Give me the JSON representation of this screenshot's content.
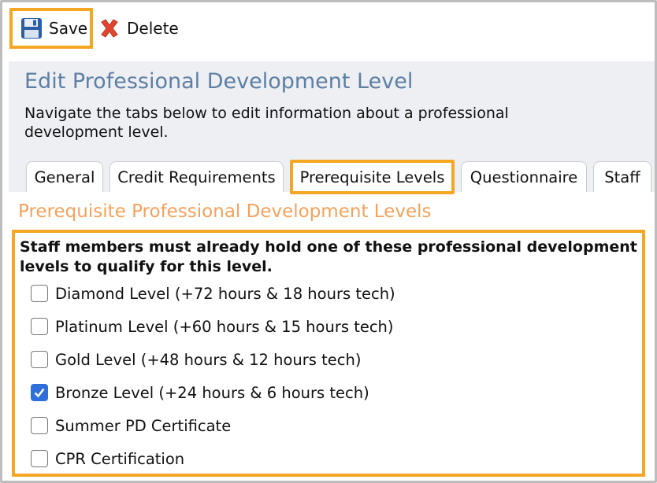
{
  "toolbar": {
    "save_label": "Save",
    "delete_label": "Delete"
  },
  "header": {
    "title": "Edit Professional Development Level",
    "subtitle": "Navigate the tabs below to edit information about a professional development level."
  },
  "tabs": [
    {
      "label": "General",
      "active": false
    },
    {
      "label": "Credit Requirements",
      "active": false
    },
    {
      "label": "Prerequisite Levels",
      "active": true
    },
    {
      "label": "Questionnaire",
      "active": false
    },
    {
      "label": "Staff",
      "active": false
    }
  ],
  "section": {
    "title": "Prerequisite Professional Development Levels",
    "description": "Staff members must already hold one of these professional development levels to qualify for this level.",
    "options": [
      {
        "label": "Diamond Level (+72 hours & 18 hours tech)",
        "checked": false
      },
      {
        "label": "Platinum Level (+60 hours & 15 hours tech)",
        "checked": false
      },
      {
        "label": "Gold Level (+48 hours & 12 hours tech)",
        "checked": false
      },
      {
        "label": "Bronze Level (+24 hours & 6 hours tech)",
        "checked": true
      },
      {
        "label": "Summer PD Certificate",
        "checked": false
      },
      {
        "label": "CPR Certification",
        "checked": false
      }
    ]
  },
  "colors": {
    "accent": "#f5a623",
    "title_blue": "#5d7fa3",
    "section_orange": "#f4a25b",
    "check_blue": "#2f6fdb"
  }
}
